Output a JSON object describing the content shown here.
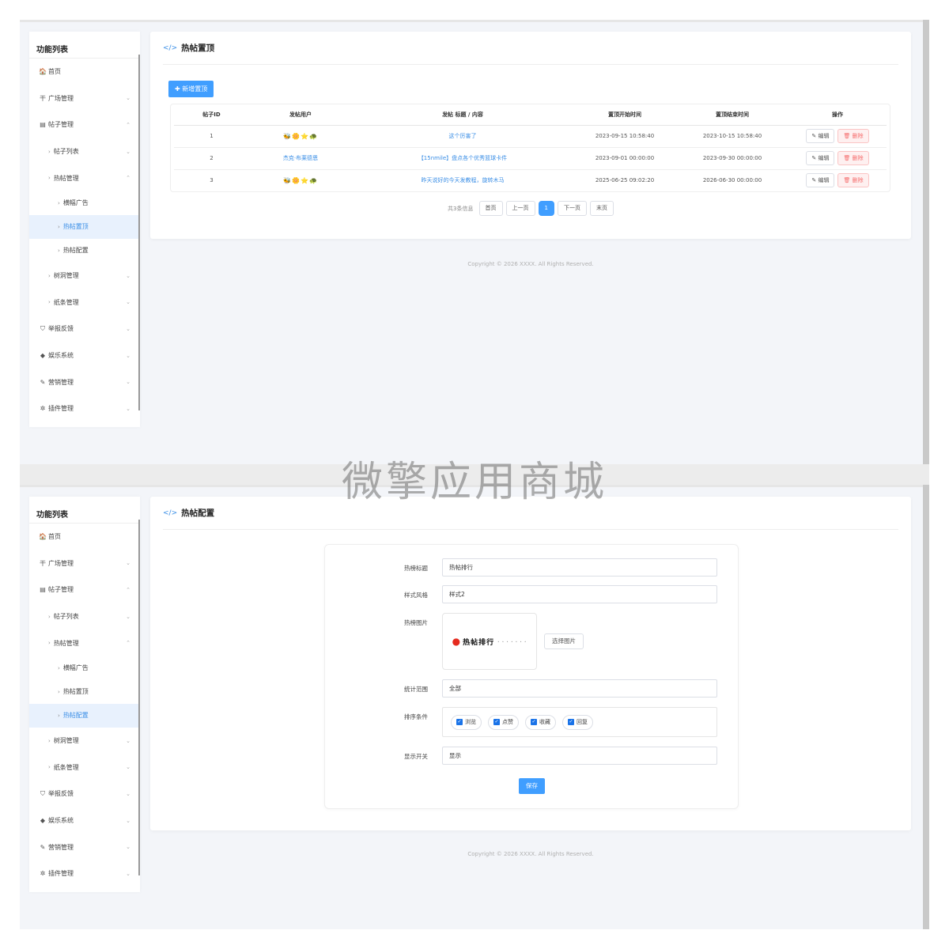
{
  "sidebar": {
    "title": "功能列表",
    "items": [
      {
        "label": "首页",
        "icon": "home-icon",
        "glyph": "🏠",
        "level": 1,
        "caret": ""
      },
      {
        "label": "广场管理",
        "icon": "square-icon",
        "glyph": "干",
        "level": 1,
        "caret": "⌄"
      },
      {
        "label": "帖子管理",
        "icon": "document-icon",
        "glyph": "▤",
        "level": 1,
        "caret": "⌃"
      },
      {
        "label": "帖子列表",
        "icon": "",
        "glyph": "",
        "level": 2,
        "caret": "⌄"
      },
      {
        "label": "热帖管理",
        "icon": "",
        "glyph": "",
        "level": 2,
        "caret": "⌃"
      },
      {
        "label": "横幅广告",
        "icon": "",
        "glyph": "",
        "level": 3,
        "caret": ""
      },
      {
        "label": "热帖置顶",
        "icon": "",
        "glyph": "",
        "level": 3,
        "caret": ""
      },
      {
        "label": "热帖配置",
        "icon": "",
        "glyph": "",
        "level": 3,
        "caret": ""
      },
      {
        "label": "树洞管理",
        "icon": "",
        "glyph": "",
        "level": 2,
        "caret": "⌄"
      },
      {
        "label": "纸条管理",
        "icon": "",
        "glyph": "",
        "level": 2,
        "caret": "⌄"
      },
      {
        "label": "举报反馈",
        "icon": "shield-icon",
        "glyph": "⛉",
        "level": 1,
        "caret": "⌄"
      },
      {
        "label": "娱乐系统",
        "icon": "tag-icon",
        "glyph": "◆",
        "level": 1,
        "caret": "⌄"
      },
      {
        "label": "营销管理",
        "icon": "pen-icon",
        "glyph": "✎",
        "level": 1,
        "caret": "⌄"
      },
      {
        "label": "插件管理",
        "icon": "plugin-icon",
        "glyph": "✲",
        "level": 1,
        "caret": "⌄"
      }
    ]
  },
  "screen1": {
    "title": "热帖置顶",
    "add_button": "新增置顶",
    "columns": [
      "帖子ID",
      "发帖用户",
      "发帖 标题 / 内容",
      "置顶开始时间",
      "置顶结束时间",
      "操作"
    ],
    "rows": [
      {
        "id": "1",
        "user": "🐝🌼⭐🐢",
        "user_link": false,
        "title": "这个厉害了",
        "start": "2023-09-15 10:58:40",
        "end": "2023-10-15 10:58:40"
      },
      {
        "id": "2",
        "user": "杰克·布莱德恩",
        "user_link": true,
        "title": "【15nmile】盘点各个优秀篮球卡件",
        "start": "2023-09-01 00:00:00",
        "end": "2023-09-30 00:00:00"
      },
      {
        "id": "3",
        "user": "🐝🌼⭐🐢",
        "user_link": false,
        "title": "昨天说好的今天发教程，旋转木马",
        "start": "2025-06-25 09:02:20",
        "end": "2026-06-30 00:00:00"
      }
    ],
    "edit_label": "编辑",
    "delete_label": "删除",
    "pager": {
      "total": "共3条信息",
      "first": "首页",
      "prev": "上一页",
      "current": "1",
      "next": "下一页",
      "last": "末页"
    }
  },
  "screen2": {
    "title": "热帖配置",
    "form": {
      "title_label": "热榜标题",
      "title_value": "热帖排行",
      "style_label": "样式风格",
      "style_value": "样式2",
      "image_label": "热榜图片",
      "image_text": "热帖排行",
      "select_image": "选择图片",
      "range_label": "统计范围",
      "range_value": "全部",
      "sort_label": "排序条件",
      "sort_options": [
        "浏览",
        "点赞",
        "收藏",
        "回复"
      ],
      "switch_label": "显示开关",
      "switch_value": "显示",
      "save": "保存"
    }
  },
  "copyright": "Copyright © 2026 XXXX. All Rights Reserved.",
  "watermark": "微擎应用商城",
  "colors": {
    "accent": "#409eff",
    "danger": "#f56c6c",
    "background": "#f3f5f9"
  }
}
